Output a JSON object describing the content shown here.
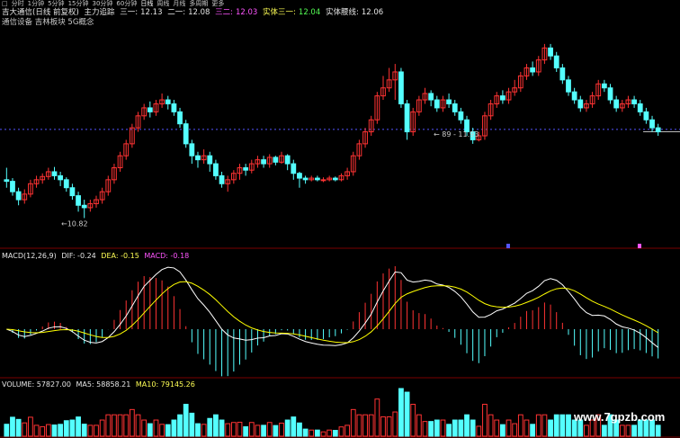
{
  "tabs": [
    "□",
    "分时",
    "1分钟",
    "5分钟",
    "15分钟",
    "30分钟",
    "60分钟",
    "日线",
    "周线",
    "月线",
    "多周期",
    "更多"
  ],
  "header": {
    "name": "吉大通信(日线 前复权)",
    "indicator": "主力追踪",
    "s1_label": "三一:",
    "s1_val": "12.13",
    "s2_label": "二一:",
    "s2_val": "12.08",
    "s3_label": "三二:",
    "s3_val": "12.03",
    "s4_label": "实体三一:",
    "s4_val": "12.04",
    "s5_label": "实体腰线:",
    "s5_val": "12.06",
    "tags": "通信设备  吉林板块  5G概念"
  },
  "annotations": {
    "high": "89 - 11.93",
    "low": "10.82"
  },
  "macd": {
    "label": "MACD(12,26,9)",
    "dif": "DIF: -0.24",
    "dea": "DEA: -0.15",
    "macd": "MACD: -0.18"
  },
  "volume": {
    "label": "VOLUME: 57827.00",
    "ma5": "MA5: 58858.21",
    "ma10": "MA10: 79145.26"
  },
  "watermark": "www.7gpzb.com",
  "colors": {
    "up": "#ff3333",
    "down": "#54ffff",
    "dif": "#ffffff",
    "dea": "#ffff00",
    "ref": "#5555ff"
  },
  "chart_data": {
    "type": "candlestick",
    "ref_price": 11.93,
    "ylim": [
      10.6,
      13.1
    ],
    "candles": [
      [
        11.3,
        11.28,
        11.45,
        11.2
      ],
      [
        11.28,
        11.15,
        11.32,
        11.1
      ],
      [
        11.15,
        11.05,
        11.2,
        10.98
      ],
      [
        11.05,
        11.12,
        11.18,
        11.0
      ],
      [
        11.12,
        11.25,
        11.3,
        11.08
      ],
      [
        11.25,
        11.3,
        11.35,
        11.2
      ],
      [
        11.3,
        11.34,
        11.38,
        11.25
      ],
      [
        11.34,
        11.4,
        11.45,
        11.3
      ],
      [
        11.4,
        11.35,
        11.46,
        11.3
      ],
      [
        11.35,
        11.3,
        11.4,
        11.22
      ],
      [
        11.3,
        11.2,
        11.33,
        11.15
      ],
      [
        11.2,
        11.1,
        11.25,
        11.05
      ],
      [
        11.1,
        10.98,
        11.15,
        10.9
      ],
      [
        10.98,
        10.95,
        11.05,
        10.82
      ],
      [
        10.95,
        11.0,
        11.05,
        10.9
      ],
      [
        11.0,
        11.05,
        11.1,
        10.95
      ],
      [
        11.05,
        11.15,
        11.2,
        11.0
      ],
      [
        11.15,
        11.3,
        11.35,
        11.1
      ],
      [
        11.3,
        11.45,
        11.5,
        11.25
      ],
      [
        11.45,
        11.6,
        11.65,
        11.4
      ],
      [
        11.6,
        11.75,
        11.8,
        11.55
      ],
      [
        11.75,
        11.95,
        12.0,
        11.7
      ],
      [
        11.95,
        12.1,
        12.15,
        11.9
      ],
      [
        12.1,
        12.2,
        12.25,
        12.05
      ],
      [
        12.2,
        12.15,
        12.28,
        12.08
      ],
      [
        12.15,
        12.25,
        12.3,
        12.1
      ],
      [
        12.25,
        12.3,
        12.38,
        12.2
      ],
      [
        12.3,
        12.25,
        12.35,
        12.18
      ],
      [
        12.25,
        12.15,
        12.3,
        12.1
      ],
      [
        12.15,
        12.0,
        12.2,
        11.95
      ],
      [
        12.0,
        11.75,
        12.05,
        11.7
      ],
      [
        11.75,
        11.6,
        11.8,
        11.5
      ],
      [
        11.6,
        11.55,
        11.65,
        11.45
      ],
      [
        11.55,
        11.6,
        11.68,
        11.5
      ],
      [
        11.6,
        11.5,
        11.65,
        11.4
      ],
      [
        11.5,
        11.35,
        11.55,
        11.3
      ],
      [
        11.35,
        11.25,
        11.4,
        11.2
      ],
      [
        11.25,
        11.3,
        11.35,
        11.15
      ],
      [
        11.3,
        11.38,
        11.42,
        11.25
      ],
      [
        11.38,
        11.45,
        11.5,
        11.3
      ],
      [
        11.45,
        11.42,
        11.5,
        11.35
      ],
      [
        11.42,
        11.5,
        11.55,
        11.38
      ],
      [
        11.5,
        11.55,
        11.6,
        11.45
      ],
      [
        11.55,
        11.5,
        11.6,
        11.45
      ],
      [
        11.5,
        11.58,
        11.62,
        11.45
      ],
      [
        11.58,
        11.52,
        11.6,
        11.48
      ],
      [
        11.52,
        11.6,
        11.65,
        11.5
      ],
      [
        11.6,
        11.5,
        11.62,
        11.42
      ],
      [
        11.5,
        11.38,
        11.55,
        11.3
      ],
      [
        11.38,
        11.32,
        11.4,
        11.2
      ],
      [
        11.32,
        11.3,
        11.35,
        11.25
      ],
      [
        11.3,
        11.32,
        11.35,
        11.28
      ],
      [
        11.32,
        11.3,
        11.35,
        11.28
      ],
      [
        11.3,
        11.3,
        11.33,
        11.27
      ],
      [
        11.3,
        11.32,
        11.35,
        11.28
      ],
      [
        11.32,
        11.3,
        11.34,
        11.28
      ],
      [
        11.3,
        11.35,
        11.38,
        11.28
      ],
      [
        11.35,
        11.4,
        11.45,
        11.3
      ],
      [
        11.4,
        11.6,
        11.65,
        11.35
      ],
      [
        11.6,
        11.75,
        11.8,
        11.55
      ],
      [
        11.75,
        11.9,
        11.95,
        11.7
      ],
      [
        11.9,
        12.05,
        12.1,
        11.85
      ],
      [
        12.05,
        12.35,
        12.4,
        12.0
      ],
      [
        12.35,
        12.45,
        12.6,
        12.3
      ],
      [
        12.45,
        12.55,
        12.7,
        12.4
      ],
      [
        12.55,
        12.65,
        12.75,
        12.3
      ],
      [
        12.65,
        12.25,
        12.7,
        12.2
      ],
      [
        12.25,
        11.9,
        12.3,
        11.8
      ],
      [
        11.9,
        12.15,
        12.2,
        11.85
      ],
      [
        12.15,
        12.3,
        12.35,
        12.1
      ],
      [
        12.3,
        12.38,
        12.45,
        12.25
      ],
      [
        12.38,
        12.3,
        12.42,
        12.22
      ],
      [
        12.3,
        12.2,
        12.35,
        12.15
      ],
      [
        12.2,
        12.3,
        12.35,
        12.15
      ],
      [
        12.3,
        12.25,
        12.38,
        12.2
      ],
      [
        12.25,
        12.15,
        12.3,
        12.1
      ],
      [
        12.15,
        12.05,
        12.2,
        12.0
      ],
      [
        12.05,
        11.9,
        12.1,
        11.85
      ],
      [
        11.9,
        11.8,
        11.95,
        11.75
      ],
      [
        11.8,
        11.85,
        11.9,
        11.78
      ],
      [
        11.85,
        12.1,
        12.15,
        11.8
      ],
      [
        12.1,
        12.25,
        12.3,
        12.05
      ],
      [
        12.25,
        12.35,
        12.4,
        12.2
      ],
      [
        12.35,
        12.3,
        12.42,
        12.25
      ],
      [
        12.3,
        12.4,
        12.45,
        12.25
      ],
      [
        12.4,
        12.45,
        12.55,
        12.35
      ],
      [
        12.45,
        12.6,
        12.65,
        12.4
      ],
      [
        12.6,
        12.7,
        12.75,
        12.55
      ],
      [
        12.7,
        12.65,
        12.78,
        12.6
      ],
      [
        12.65,
        12.8,
        12.85,
        12.6
      ],
      [
        12.8,
        12.95,
        13.0,
        12.75
      ],
      [
        12.95,
        12.85,
        13.0,
        12.8
      ],
      [
        12.85,
        12.7,
        12.9,
        12.65
      ],
      [
        12.7,
        12.55,
        12.75,
        12.5
      ],
      [
        12.55,
        12.4,
        12.6,
        12.35
      ],
      [
        12.4,
        12.3,
        12.45,
        12.25
      ],
      [
        12.3,
        12.2,
        12.35,
        12.15
      ],
      [
        12.2,
        12.25,
        12.3,
        12.15
      ],
      [
        12.25,
        12.35,
        12.4,
        12.2
      ],
      [
        12.35,
        12.5,
        12.55,
        12.3
      ],
      [
        12.5,
        12.45,
        12.55,
        12.4
      ],
      [
        12.45,
        12.3,
        12.5,
        12.25
      ],
      [
        12.3,
        12.2,
        12.35,
        12.15
      ],
      [
        12.2,
        12.25,
        12.3,
        12.15
      ],
      [
        12.25,
        12.3,
        12.35,
        12.2
      ],
      [
        12.3,
        12.25,
        12.35,
        12.2
      ],
      [
        12.25,
        12.15,
        12.3,
        12.1
      ],
      [
        12.15,
        12.05,
        12.2,
        12.0
      ],
      [
        12.05,
        11.95,
        12.1,
        11.9
      ],
      [
        11.95,
        11.9,
        12.0,
        11.85
      ]
    ]
  }
}
